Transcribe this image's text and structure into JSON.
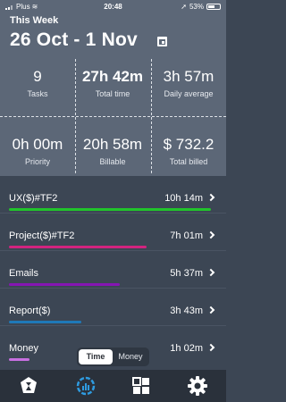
{
  "status_bar": {
    "carrier": "Plus",
    "time": "20:48",
    "battery": "53%"
  },
  "header": {
    "week_label": "This Week",
    "date_range": "26 Oct - 1 Nov"
  },
  "stats": [
    {
      "value": "9",
      "label": "Tasks"
    },
    {
      "value": "27h 42m",
      "label": "Total time"
    },
    {
      "value": "3h 57m",
      "label": "Daily average"
    },
    {
      "value": "0h 00m",
      "label": "Priority"
    },
    {
      "value": "20h 58m",
      "label": "Billable"
    },
    {
      "value": "$ 732.2",
      "label": "Total billed"
    }
  ],
  "projects": [
    {
      "name": "UX($)#TF2",
      "time": "10h 14m",
      "color": "#21c42b",
      "fraction": 1.0
    },
    {
      "name": "Project($)#TF2",
      "time": "7h 01m",
      "color": "#d2237f",
      "fraction": 0.68
    },
    {
      "name": "Emails",
      "time": "5h 37m",
      "color": "#8616b3",
      "fraction": 0.55
    },
    {
      "name": "Report($)",
      "time": "3h 43m",
      "color": "#1f79b8",
      "fraction": 0.36
    },
    {
      "name": "Money",
      "time": "1h 02m",
      "color": "#c76fe0",
      "fraction": 0.1
    }
  ],
  "toggle": {
    "active": "Time",
    "inactive": "Money"
  },
  "tabs": [
    {
      "icon": "hourglass-icon"
    },
    {
      "icon": "stats-ring-icon"
    },
    {
      "icon": "grid-icon"
    },
    {
      "icon": "gear-icon"
    }
  ],
  "colors": {
    "header_bg": "#5c6777",
    "body_bg": "#3c4654",
    "tabbar_bg": "#2a313b",
    "accent": "#21c42b"
  }
}
